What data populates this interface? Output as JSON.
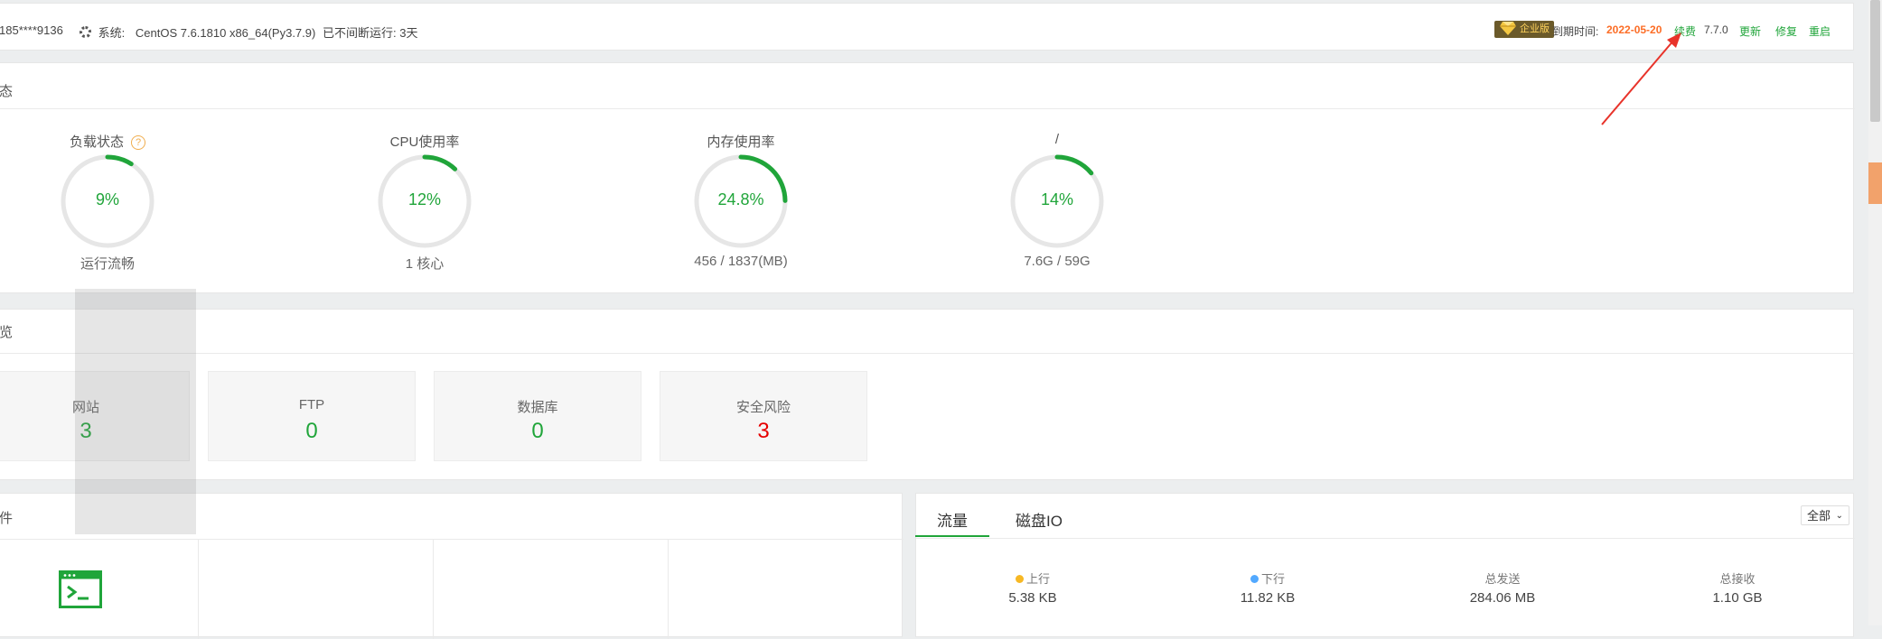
{
  "topbar": {
    "account": "185****9136",
    "system_label": "系统:",
    "system_value": "CentOS 7.6.1810 x86_64(Py3.7.9)",
    "uptime": "已不间断运行: 3天",
    "edition_badge": "企业版",
    "expire_label": "到期时间:",
    "expire_date": "2022-05-20",
    "renew": "续费",
    "version": "7.7.0",
    "update": "更新",
    "repair": "修复",
    "restart": "重启"
  },
  "status_panel": {
    "title_fragment": "态",
    "gauges": [
      {
        "label": "负载状态",
        "value": "9%",
        "percent": 9,
        "sub": "运行流畅",
        "help": "?"
      },
      {
        "label": "CPU使用率",
        "value": "12%",
        "percent": 12,
        "sub": "1 核心"
      },
      {
        "label": "内存使用率",
        "value": "24.8%",
        "percent": 24.8,
        "sub": "456 / 1837(MB)"
      },
      {
        "label": "/",
        "value": "14%",
        "percent": 14,
        "sub": "7.6G / 59G"
      }
    ]
  },
  "overview_panel": {
    "title_fragment": "览",
    "cards": [
      {
        "title": "网站",
        "value": "3"
      },
      {
        "title": "FTP",
        "value": "0"
      },
      {
        "title": "数据库",
        "value": "0"
      },
      {
        "title": "安全风险",
        "value": "3"
      }
    ]
  },
  "software_panel": {
    "title_fragment": "件"
  },
  "traffic_panel": {
    "tabs": [
      "流量",
      "磁盘IO"
    ],
    "select_value": "全部",
    "stats": [
      {
        "label": "上行",
        "value": "5.38 KB"
      },
      {
        "label": "下行",
        "value": "11.82 KB"
      },
      {
        "label": "总发送",
        "value": "284.06 MB"
      },
      {
        "label": "总接收",
        "value": "1.10 GB"
      }
    ]
  },
  "colors": {
    "accent_green": "#20a53a",
    "danger_red": "#e60000",
    "expire_orange": "#fc6d26",
    "upload_dot": "#f7b824",
    "download_dot": "#52a9ff",
    "annotation_arrow": "#e8332a"
  },
  "icons": {
    "settings": "gear-icon",
    "edition": "diamond-icon",
    "help": "question-circle-icon",
    "terminal": "terminal-icon",
    "dropdown": "chevron-down-icon"
  }
}
